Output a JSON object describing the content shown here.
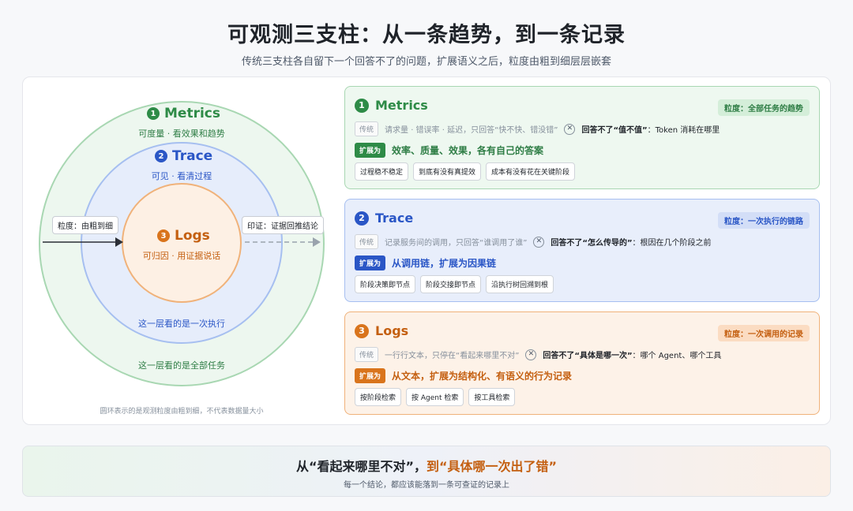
{
  "header": {
    "title": "可观测三支柱：从一条趋势，到一条记录",
    "subtitle": "传统三支柱各自留下一个回答不了的问题，扩展语义之后，粒度由粗到细层层嵌套"
  },
  "diagram": {
    "outer": {
      "num": "1",
      "name": "Metrics",
      "sub": "可度量 · 看效果和趋势",
      "scope": "这一层看的是全部任务"
    },
    "middle": {
      "num": "2",
      "name": "Trace",
      "sub": "可见 · 看清过程",
      "scope": "这一层看的是一次执行"
    },
    "inner": {
      "num": "3",
      "name": "Logs",
      "sub": "可归因 · 用证据说话"
    },
    "left_tag": "粒度：由粗到细",
    "right_tag": "印证：证据回推结论",
    "footnote": "圆环表示的是观测粒度由粗到细，不代表数据量大小"
  },
  "panels": [
    {
      "num": "1",
      "name": "Metrics",
      "badge": "粒度：全部任务的趋势",
      "legacy_label": "传统",
      "legacy": "请求量 · 错误率 · 延迟，只回答“快不快、错没错”",
      "cant_prefix": "回答不了“值不值”",
      "cant_rest": "：Token 消耗在哪里",
      "expand_label": "扩展为",
      "expand": "效率、质量、效果，各有自己的答案",
      "pills": [
        "过程稳不稳定",
        "到底有没有真提效",
        "成本有没有花在关键阶段"
      ]
    },
    {
      "num": "2",
      "name": "Trace",
      "badge": "粒度：一次执行的链路",
      "legacy_label": "传统",
      "legacy": "记录服务间的调用，只回答“谁调用了谁”",
      "cant_prefix": "回答不了“怎么传导的”",
      "cant_rest": "：根因在几个阶段之前",
      "expand_label": "扩展为",
      "expand": "从调用链，扩展为因果链",
      "pills": [
        "阶段决策即节点",
        "阶段交接即节点",
        "沿执行树回溯到根"
      ]
    },
    {
      "num": "3",
      "name": "Logs",
      "badge": "粒度：一次调用的记录",
      "legacy_label": "传统",
      "legacy": "一行行文本，只停在“看起来哪里不对”",
      "cant_prefix": "回答不了“具体是哪一次”",
      "cant_rest": "：哪个 Agent、哪个工具",
      "expand_label": "扩展为",
      "expand": "从文本，扩展为结构化、有语义的行为记录",
      "pills": [
        "按阶段检索",
        "按 Agent 检索",
        "按工具检索"
      ]
    }
  ],
  "banner": {
    "from": "从“看起来哪里不对”，",
    "to": "到“具体哪一次出了错”",
    "sub": "每一个结论，都应该能落到一条可查证的记录上"
  },
  "colors": {
    "green": "#2e8b47",
    "blue": "#2a56c6",
    "orange": "#d9741c",
    "green_badge_bg": "#d4eed9",
    "blue_badge_bg": "#d3def7",
    "orange_badge_bg": "#fbdcc2"
  }
}
